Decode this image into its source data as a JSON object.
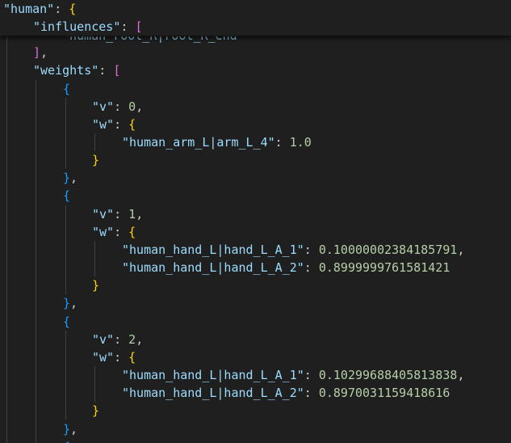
{
  "code": {
    "human_key": "\"human\"",
    "influences_key": "\"influences\"",
    "influences_partial": "human_root_R|root_R_end",
    "weights_key": "\"weights\"",
    "v_key": "\"v\"",
    "w_key": "\"w\"",
    "entries": [
      {
        "v": "0",
        "weights": [
          {
            "key": "\"human_arm_L|arm_L_4\"",
            "value": "1.0"
          }
        ]
      },
      {
        "v": "1",
        "weights": [
          {
            "key": "\"human_hand_L|hand_L_A_1\"",
            "value": "0.10000002384185791"
          },
          {
            "key": "\"human_hand_L|hand_L_A_2\"",
            "value": "0.8999999761581421"
          }
        ]
      },
      {
        "v": "2",
        "weights": [
          {
            "key": "\"human_hand_L|hand_L_A_1\"",
            "value": "0.10299688405813838"
          },
          {
            "key": "\"human_hand_L|hand_L_A_2\"",
            "value": "0.8970031159418616"
          }
        ]
      }
    ]
  },
  "colors": {
    "background": "#1f1f1f",
    "key": "#9cdcfe",
    "number": "#b5cea8",
    "punctuation": "#cccccc",
    "bracket_level1": "#ffd700",
    "bracket_level2": "#da70d6",
    "bracket_level3": "#179fff"
  }
}
